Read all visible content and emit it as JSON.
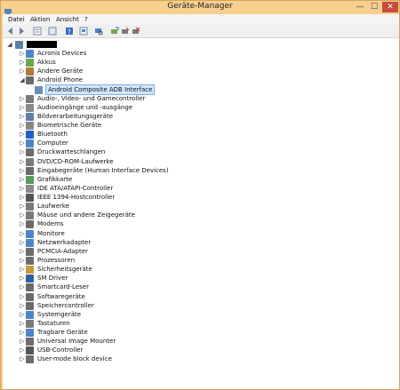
{
  "window": {
    "title": "Geräte-Manager",
    "min": "—",
    "max": "☐",
    "close": "✕"
  },
  "menu": [
    "Datei",
    "Aktion",
    "Ansicht",
    "?"
  ],
  "toolbar": [
    "back-icon",
    "forward-icon",
    "properties-icon",
    "view-icon",
    "help-icon",
    "show-hidden-icon",
    "scan-icon",
    "update-driver-icon",
    "disable-icon"
  ],
  "tree": {
    "root_expander": "◢",
    "items": [
      {
        "label": "Acronis Devices",
        "icon": "device-icon",
        "color": "#4a86c7",
        "expander": "▷"
      },
      {
        "label": "Akkus",
        "icon": "battery-icon",
        "color": "#6aa84f",
        "expander": "▷"
      },
      {
        "label": "Andere Geräte",
        "icon": "unknown-device-icon",
        "color": "#b07a3a",
        "expander": "▷"
      },
      {
        "label": "Android Phone",
        "icon": "phone-icon",
        "color": "#6b6b6b",
        "expander": "◢"
      },
      {
        "label": "Android Composite ADB Interface",
        "icon": "adb-icon",
        "color": "#6b8fb8",
        "expander": "",
        "child": true,
        "selected": true
      },
      {
        "label": "Audio-, Video- und Gamecontroller",
        "icon": "audio-icon",
        "color": "#7a7a7a",
        "expander": "▷"
      },
      {
        "label": "Audioeingänge und -ausgänge",
        "icon": "speaker-icon",
        "color": "#8a8a8a",
        "expander": "▷"
      },
      {
        "label": "Bildverarbeitungsgeräte",
        "icon": "camera-icon",
        "color": "#5a7fa8",
        "expander": "▷"
      },
      {
        "label": "Biometrische Geräte",
        "icon": "fingerprint-icon",
        "color": "#888888",
        "expander": "▷"
      },
      {
        "label": "Bluetooth",
        "icon": "bluetooth-icon",
        "color": "#1f5fbf",
        "expander": "▷"
      },
      {
        "label": "Computer",
        "icon": "computer-icon",
        "color": "#4a86c7",
        "expander": "▷"
      },
      {
        "label": "Druckwarteschlangen",
        "icon": "printer-icon",
        "color": "#6b6b6b",
        "expander": "▷"
      },
      {
        "label": "DVD/CD-ROM-Laufwerke",
        "icon": "dvd-icon",
        "color": "#7a7a7a",
        "expander": "▷"
      },
      {
        "label": "Eingabegeräte (Human Interface Devices)",
        "icon": "hid-icon",
        "color": "#6b6b6b",
        "expander": "▷"
      },
      {
        "label": "Grafikkarte",
        "icon": "display-adapter-icon",
        "color": "#5a9a5a",
        "expander": "▷"
      },
      {
        "label": "IDE ATA/ATAPI-Controller",
        "icon": "ide-controller-icon",
        "color": "#8a8a8a",
        "expander": "▷"
      },
      {
        "label": "IEEE 1394-Hostcontroller",
        "icon": "firewire-icon",
        "color": "#555555",
        "expander": "▷"
      },
      {
        "label": "Laufwerke",
        "icon": "disk-drive-icon",
        "color": "#7a7a7a",
        "expander": "▷"
      },
      {
        "label": "Mäuse und andere Zeigegeräte",
        "icon": "mouse-icon",
        "color": "#7a7a7a",
        "expander": "▷"
      },
      {
        "label": "Modems",
        "icon": "modem-icon",
        "color": "#6b6b6b",
        "expander": "▷"
      },
      {
        "label": "Monitore",
        "icon": "monitor-icon",
        "color": "#4a86c7",
        "expander": "▷"
      },
      {
        "label": "Netzwerkadapter",
        "icon": "network-icon",
        "color": "#4a86c7",
        "expander": "▷"
      },
      {
        "label": "PCMCIA-Adapter",
        "icon": "pcmcia-icon",
        "color": "#6b6b6b",
        "expander": "▷"
      },
      {
        "label": "Prozessoren",
        "icon": "cpu-icon",
        "color": "#6b6b6b",
        "expander": "▷"
      },
      {
        "label": "Sicherheitsgeräte",
        "icon": "security-device-icon",
        "color": "#c89b3a",
        "expander": "▷"
      },
      {
        "label": "SM Driver",
        "icon": "sm-driver-icon",
        "color": "#2f5fa8",
        "expander": "▷"
      },
      {
        "label": "Smartcard-Leser",
        "icon": "smartcard-icon",
        "color": "#6b6b6b",
        "expander": "▷"
      },
      {
        "label": "Softwaregeräte",
        "icon": "software-device-icon",
        "color": "#6b6b6b",
        "expander": "▷"
      },
      {
        "label": "Speichercontroller",
        "icon": "storage-controller-icon",
        "color": "#6b6b6b",
        "expander": "▷"
      },
      {
        "label": "Systemgeräte",
        "icon": "system-device-icon",
        "color": "#4a86c7",
        "expander": "▷"
      },
      {
        "label": "Tastaturen",
        "icon": "keyboard-icon",
        "color": "#7a7a7a",
        "expander": "▷"
      },
      {
        "label": "Tragbare Geräte",
        "icon": "portable-device-icon",
        "color": "#4a86c7",
        "expander": "▷"
      },
      {
        "label": "Universal Image Mounter",
        "icon": "image-mounter-icon",
        "color": "#6b6b6b",
        "expander": "▷"
      },
      {
        "label": "USB-Controller",
        "icon": "usb-icon",
        "color": "#555555",
        "expander": "▷"
      },
      {
        "label": "User-mode block device",
        "icon": "block-device-icon",
        "color": "#6b6b6b",
        "expander": "▷"
      }
    ]
  }
}
